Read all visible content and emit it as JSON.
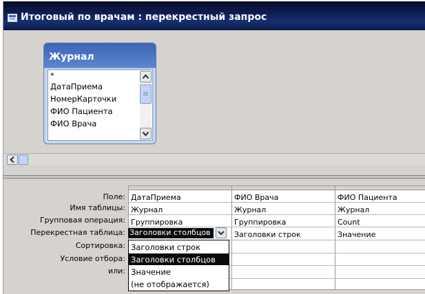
{
  "window": {
    "title": "Итоговый по врачам : перекрестный запрос"
  },
  "table": {
    "name": "Журнал",
    "fields": [
      "*",
      "ДатаПриема",
      "НомерКарточки",
      "ФИО Пациента",
      "ФИО Врача"
    ]
  },
  "grid": {
    "row_labels": [
      "Поле:",
      "Имя таблицы:",
      "Групповая операция:",
      "Перекрестная таблица:",
      "Сортировка:",
      "Условие отбора:",
      "или:"
    ],
    "columns": [
      {
        "field": "ДатаПриема",
        "table": "Журнал",
        "group": "Группировка",
        "crosstab": "Заголовки столбцов"
      },
      {
        "field": "ФИО Врача",
        "table": "Журнал",
        "group": "Группировка",
        "crosstab": "Заголовки строк"
      },
      {
        "field": "ФИО Пациента",
        "table": "Журнал",
        "group": "Count",
        "crosstab": "Значение"
      }
    ]
  },
  "dropdown": {
    "value": "Заголовки столбцов",
    "options": [
      "Заголовки строк",
      "Заголовки столбцов",
      "Значение",
      "(не отображается)"
    ],
    "selected": "Заголовки столбцов"
  },
  "colors": {
    "title_bar": "#0f1f5a",
    "table_header": "#4a72c0",
    "selection": "#0a0a0a",
    "panel": "#d6d3ce"
  }
}
